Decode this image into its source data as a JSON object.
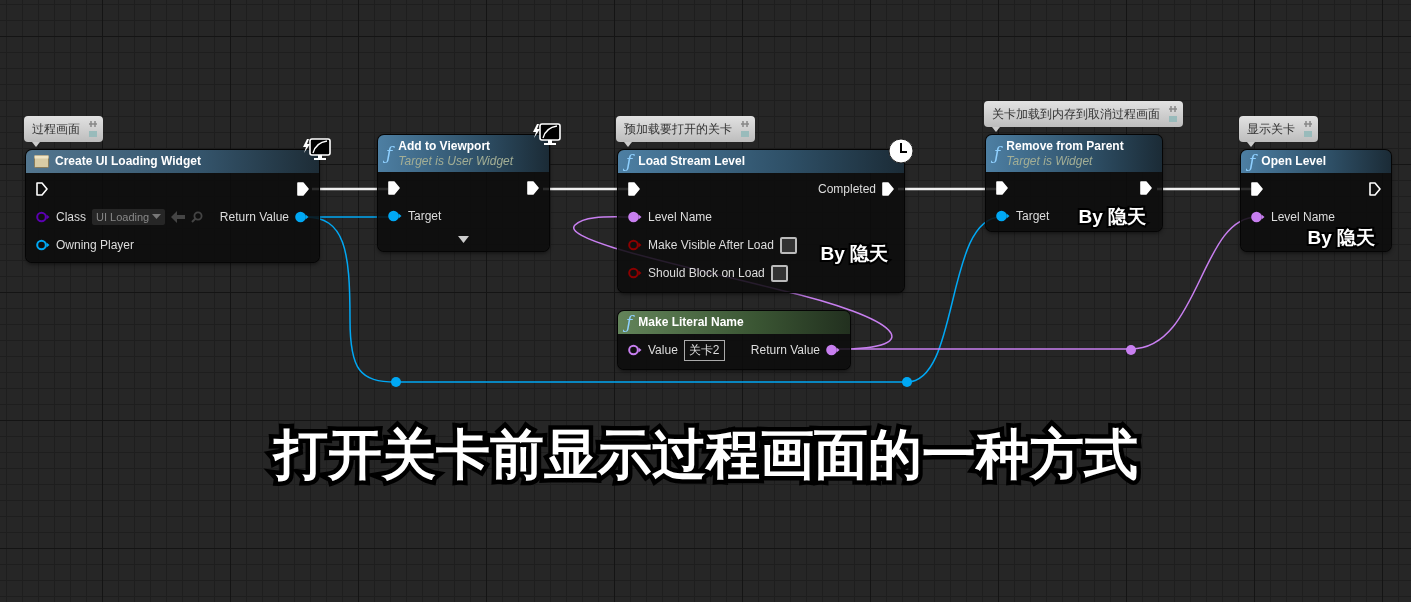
{
  "nodes": [
    {
      "comment": "过程画面",
      "title": "Create UI Loading Widget",
      "kind": "widget",
      "latent": false,
      "client_only": true,
      "advanced": false,
      "rows": [
        {
          "left": {
            "kind": "exec",
            "connected": false
          },
          "right": {
            "kind": "exec",
            "connected": true
          }
        },
        {
          "left": {
            "kind": "class",
            "label": "Class",
            "connected": false,
            "default": {
              "kind": "dropdown",
              "text": "UI Loading"
            }
          },
          "right": {
            "kind": "object",
            "label": "Return Value",
            "connected": true
          }
        },
        {
          "left": {
            "kind": "object",
            "label": "Owning Player",
            "connected": false
          }
        }
      ]
    },
    {
      "icon": "ƒ",
      "title": "Add to Viewport",
      "subtitle": "Target is User Widget",
      "kind": "function",
      "latent": false,
      "client_only": true,
      "advanced": true,
      "rows": [
        {
          "left": {
            "kind": "exec",
            "connected": true
          },
          "right": {
            "kind": "exec",
            "connected": true
          }
        },
        {
          "left": {
            "kind": "object",
            "label": "Target",
            "connected": true
          }
        }
      ]
    },
    {
      "comment": "预加载要打开的关卡",
      "icon": "ƒ",
      "title": "Load Stream Level",
      "kind": "function",
      "latent": true,
      "client_only": false,
      "advanced": false,
      "signature": "By 隐天",
      "rows": [
        {
          "left": {
            "kind": "exec",
            "connected": true
          },
          "right": {
            "kind": "exec",
            "label": "Completed",
            "connected": true
          }
        },
        {
          "left": {
            "kind": "name",
            "label": "Level Name",
            "connected": true
          }
        },
        {
          "left": {
            "kind": "bool",
            "label": "Make Visible After Load",
            "connected": false,
            "default": {
              "kind": "checkbox",
              "checked": false
            }
          }
        },
        {
          "left": {
            "kind": "bool",
            "label": "Should Block on Load",
            "connected": false,
            "default": {
              "kind": "checkbox",
              "checked": false
            }
          }
        }
      ]
    },
    {
      "icon": "ƒ",
      "title": "Make Literal Name",
      "kind": "pure",
      "latent": false,
      "client_only": false,
      "advanced": false,
      "rows": [
        {
          "left": {
            "kind": "name",
            "label": "Value",
            "connected": false,
            "default": {
              "kind": "text",
              "text": "关卡2"
            }
          },
          "right": {
            "kind": "name",
            "label": "Return Value",
            "connected": true
          }
        }
      ]
    },
    {
      "comment": "关卡加载到内存到取消过程画面",
      "icon": "ƒ",
      "title": "Remove from Parent",
      "subtitle": "Target is Widget",
      "kind": "function",
      "latent": false,
      "client_only": false,
      "advanced": false,
      "signature": "By 隐天",
      "rows": [
        {
          "left": {
            "kind": "exec",
            "connected": true
          },
          "right": {
            "kind": "exec",
            "connected": true
          }
        },
        {
          "left": {
            "kind": "object",
            "label": "Target",
            "connected": true
          }
        }
      ]
    },
    {
      "comment": "显示关卡",
      "icon": "ƒ",
      "title": "Open Level",
      "kind": "function",
      "latent": false,
      "client_only": false,
      "advanced": false,
      "signature": "By 隐天",
      "rows": [
        {
          "left": {
            "kind": "exec",
            "connected": true
          },
          "right": {
            "kind": "exec",
            "connected": false
          }
        },
        {
          "left": {
            "kind": "name",
            "label": "Level Name",
            "connected": true
          }
        }
      ]
    }
  ],
  "caption": "打开关卡前显示过程画面的一种方式"
}
